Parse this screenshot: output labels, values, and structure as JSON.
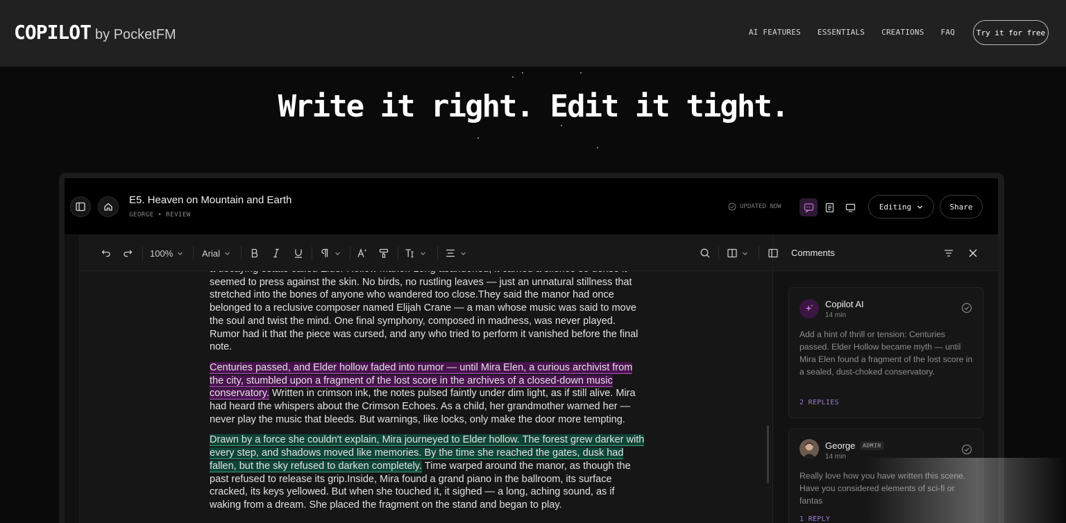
{
  "brand": {
    "name": "COPILOT",
    "by": "by PocketFM"
  },
  "nav": {
    "links": [
      "AI FEATURES",
      "ESSENTIALS",
      "CREATIONS",
      "FAQ"
    ],
    "cta": "Try it for free"
  },
  "hero": {
    "title": "Write it right. Edit it tight."
  },
  "app": {
    "doc_title": "E5. Heaven on Mountain and Earth",
    "doc_sub": "GEORGE • REVIEW",
    "updated": "UPDATED NOW",
    "mode": "Editing",
    "share": "Share",
    "toolbar": {
      "zoom": "100%",
      "font": "Arial"
    },
    "editor": {
      "p1": "a decaying estate called Elder Hollow Manor. Long abandoned, it carried a silence so dense it seemed to press against the skin. No birds, no rustling leaves — just an unnatural stillness that stretched into the bones of anyone who wandered too close.They said the manor had once belonged to a reclusive composer named Elijah Crane — a man whose music was said to move the soul and twist the mind. One final symphony, composed in madness, was never played. Rumor had it that the piece was cursed, and any who tried to perform it vanished before the final note.",
      "p2_highlight": "Centuries passed, and Elder hollow faded into rumor — until Mira Elen, a curious archivist from the city, stumbled upon a fragment of the lost score in the archives of a closed-down music conservatory.",
      "p2_rest": " Written in crimson ink, the notes pulsed faintly under dim light, as if still alive. Mira had heard the whispers about the Crimson Echoes. As a child, her grandmother warned her — never play the music that bleeds. But warnings, like locks, only make the door more tempting.",
      "p3_highlight": "Drawn by a force she couldn't explain, Mira journeyed to Elder hollow. The forest grew darker with every step, and shadows moved like memories. By the time she reached the gates, dusk had fallen, but the sky refused to darken completely.",
      "p3_rest": " Time warped around the manor, as though the past refused to release its grip.Inside, Mira found a grand piano in the ballroom, its surface cracked, its keys yellowed. But when she touched it, it sighed — a long, aching sound, as if waking from a dream. She placed the fragment on the stand and began to play."
    },
    "comments": {
      "title": "Comments",
      "items": [
        {
          "name": "Copilot AI",
          "time": "14 min",
          "body": "Add a hint of thrill or tension: Centuries passed. Elder Hollow became myth — until Mira Elen found a fragment of the lost score in a sealed, dust-choked conservatory.",
          "replies": "2 REPLIES"
        },
        {
          "name": "George",
          "badge": "ADMIN",
          "time": "14 min",
          "body": "Really love how you have written this scene. Have you considered elements of sci-fi or fantas",
          "replies": "1 REPLY"
        }
      ]
    }
  },
  "colors": {
    "highlight_purple": "#4a1350",
    "highlight_green": "#0f4535",
    "accent": "#9b7bd8"
  }
}
